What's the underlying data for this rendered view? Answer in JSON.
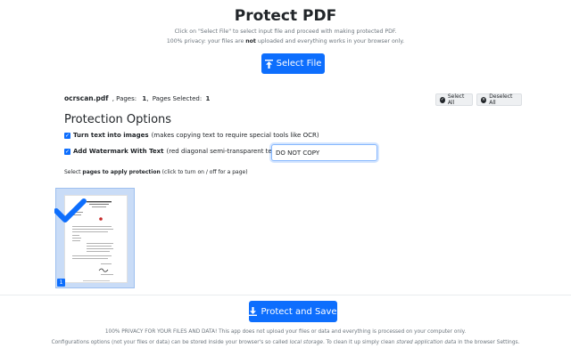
{
  "page": {
    "title": "Protect PDF",
    "subtitle": "Click on \"Select File\" to select input file and proceed with making protected PDF.",
    "privacy_pre": "100% privacy: your files are ",
    "privacy_bold": "not",
    "privacy_post": " uploaded and everything works in your browser only."
  },
  "select_file": {
    "label": "Select File",
    "icon": "upload-icon"
  },
  "file_info": {
    "name": "ocrscan.pdf",
    "pages_label": "Pages:",
    "pages": "1",
    "selected_label": "Pages Selected:",
    "selected": "1"
  },
  "selection_buttons": {
    "select_all": "Select All",
    "deselect_all": "Deselect All"
  },
  "options": {
    "heading": "Protection Options",
    "text_to_images": {
      "checked": true,
      "label": "Turn text into images",
      "hint": "(makes copying text to require special tools like OCR)"
    },
    "watermark": {
      "checked": true,
      "label": "Add Watermark With Text",
      "hint": "(red diagonal semi-transparent text):",
      "value": "DO NOT COPY"
    }
  },
  "pages_section": {
    "pre": "Select ",
    "bold": "pages to apply protection",
    "post": " (click to turn on / off for a page)",
    "thumbnails": [
      {
        "number": "1",
        "selected": true
      }
    ]
  },
  "protect_button": {
    "label": "Protect and Save",
    "icon": "download-icon"
  },
  "footer": {
    "line1": "100% PRIVACY FOR YOUR FILES AND DATA! This app does not upload your files or data and everything is processed on your computer only.",
    "line2_pre": "Configurations options (not your files or data) can be stored inside your browser's so called ",
    "line2_em1": "local storage",
    "line2_mid": ". To clean it up simply clean ",
    "line2_em2": "stored application data",
    "line2_post": " in the browser Settings."
  },
  "colors": {
    "primary": "#0d6efd",
    "thumb_selected_bg": "#c9dcf7",
    "muted": "#6c757d"
  }
}
